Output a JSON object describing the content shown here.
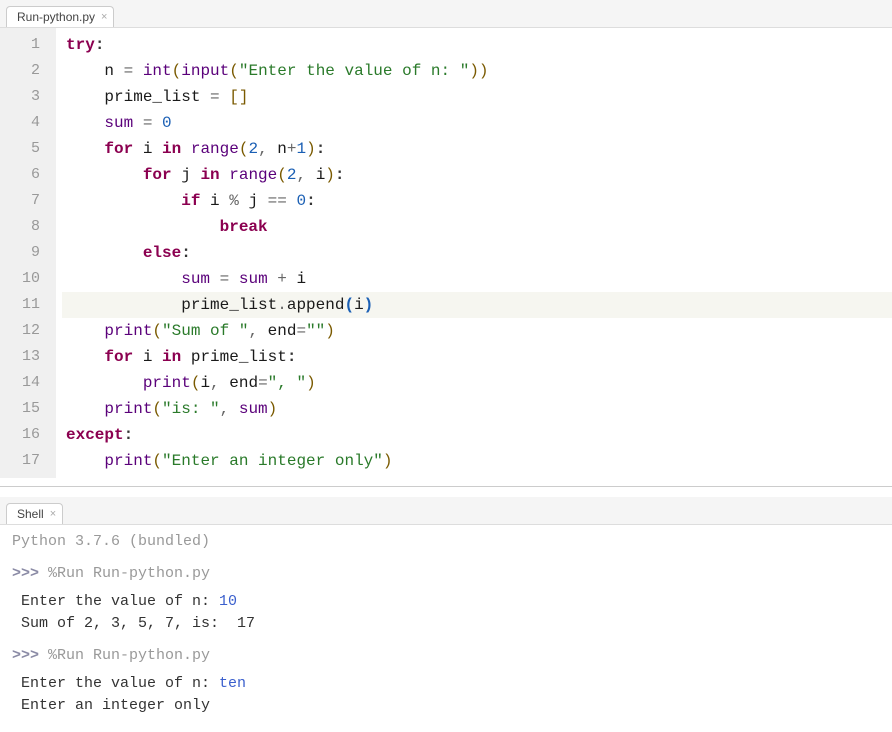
{
  "editor": {
    "tab": {
      "label": "Run-python.py"
    },
    "lineNumbers": [
      "1",
      "2",
      "3",
      "4",
      "5",
      "6",
      "7",
      "8",
      "9",
      "10",
      "11",
      "12",
      "13",
      "14",
      "15",
      "16",
      "17"
    ],
    "highlightLine": 11,
    "code": [
      {
        "indent": 0,
        "tokens": [
          {
            "t": "kw",
            "v": "try"
          },
          {
            "t": "bld",
            "v": ":"
          }
        ]
      },
      {
        "indent": 1,
        "tokens": [
          {
            "t": "name",
            "v": "n "
          },
          {
            "t": "op",
            "v": "="
          },
          {
            "t": "name",
            "v": " "
          },
          {
            "t": "bilt",
            "v": "int"
          },
          {
            "t": "par",
            "v": "("
          },
          {
            "t": "bilt",
            "v": "input"
          },
          {
            "t": "par",
            "v": "("
          },
          {
            "t": "str",
            "v": "\"Enter the value of n: \""
          },
          {
            "t": "par",
            "v": "))"
          }
        ]
      },
      {
        "indent": 1,
        "tokens": [
          {
            "t": "name",
            "v": "prime_list "
          },
          {
            "t": "op",
            "v": "="
          },
          {
            "t": "name",
            "v": " "
          },
          {
            "t": "par",
            "v": "[]"
          }
        ]
      },
      {
        "indent": 1,
        "tokens": [
          {
            "t": "bilt",
            "v": "sum"
          },
          {
            "t": "name",
            "v": " "
          },
          {
            "t": "op",
            "v": "="
          },
          {
            "t": "name",
            "v": " "
          },
          {
            "t": "num",
            "v": "0"
          }
        ]
      },
      {
        "indent": 1,
        "tokens": [
          {
            "t": "kw",
            "v": "for"
          },
          {
            "t": "name",
            "v": " i "
          },
          {
            "t": "kw",
            "v": "in"
          },
          {
            "t": "name",
            "v": " "
          },
          {
            "t": "bilt",
            "v": "range"
          },
          {
            "t": "par",
            "v": "("
          },
          {
            "t": "num",
            "v": "2"
          },
          {
            "t": "op",
            "v": ", "
          },
          {
            "t": "name",
            "v": "n"
          },
          {
            "t": "op",
            "v": "+"
          },
          {
            "t": "num",
            "v": "1"
          },
          {
            "t": "par",
            "v": ")"
          },
          {
            "t": "bld",
            "v": ":"
          }
        ]
      },
      {
        "indent": 2,
        "tokens": [
          {
            "t": "kw",
            "v": "for"
          },
          {
            "t": "name",
            "v": " j "
          },
          {
            "t": "kw",
            "v": "in"
          },
          {
            "t": "name",
            "v": " "
          },
          {
            "t": "bilt",
            "v": "range"
          },
          {
            "t": "par",
            "v": "("
          },
          {
            "t": "num",
            "v": "2"
          },
          {
            "t": "op",
            "v": ", "
          },
          {
            "t": "name",
            "v": "i"
          },
          {
            "t": "par",
            "v": ")"
          },
          {
            "t": "bld",
            "v": ":"
          }
        ]
      },
      {
        "indent": 3,
        "tokens": [
          {
            "t": "kw",
            "v": "if"
          },
          {
            "t": "name",
            "v": " i "
          },
          {
            "t": "op",
            "v": "%"
          },
          {
            "t": "name",
            "v": " j "
          },
          {
            "t": "op",
            "v": "=="
          },
          {
            "t": "name",
            "v": " "
          },
          {
            "t": "num",
            "v": "0"
          },
          {
            "t": "bld",
            "v": ":"
          }
        ]
      },
      {
        "indent": 4,
        "tokens": [
          {
            "t": "kw",
            "v": "break"
          }
        ]
      },
      {
        "indent": 2,
        "tokens": [
          {
            "t": "kw",
            "v": "else"
          },
          {
            "t": "bld",
            "v": ":"
          }
        ]
      },
      {
        "indent": 3,
        "tokens": [
          {
            "t": "bilt",
            "v": "sum"
          },
          {
            "t": "name",
            "v": " "
          },
          {
            "t": "op",
            "v": "="
          },
          {
            "t": "name",
            "v": " "
          },
          {
            "t": "bilt",
            "v": "sum"
          },
          {
            "t": "name",
            "v": " "
          },
          {
            "t": "op",
            "v": "+"
          },
          {
            "t": "name",
            "v": " i"
          }
        ]
      },
      {
        "indent": 3,
        "tokens": [
          {
            "t": "name",
            "v": "prime_list"
          },
          {
            "t": "op",
            "v": "."
          },
          {
            "t": "name",
            "v": "append"
          },
          {
            "t": "parb",
            "v": "("
          },
          {
            "t": "name",
            "v": "i"
          },
          {
            "t": "parb",
            "v": ")"
          }
        ]
      },
      {
        "indent": 1,
        "tokens": [
          {
            "t": "bilt",
            "v": "print"
          },
          {
            "t": "par",
            "v": "("
          },
          {
            "t": "str",
            "v": "\"Sum of \""
          },
          {
            "t": "op",
            "v": ", "
          },
          {
            "t": "name",
            "v": "end"
          },
          {
            "t": "op",
            "v": "="
          },
          {
            "t": "str",
            "v": "\"\""
          },
          {
            "t": "par",
            "v": ")"
          }
        ]
      },
      {
        "indent": 1,
        "tokens": [
          {
            "t": "kw",
            "v": "for"
          },
          {
            "t": "name",
            "v": " i "
          },
          {
            "t": "kw",
            "v": "in"
          },
          {
            "t": "name",
            "v": " prime_list"
          },
          {
            "t": "bld",
            "v": ":"
          }
        ]
      },
      {
        "indent": 2,
        "tokens": [
          {
            "t": "bilt",
            "v": "print"
          },
          {
            "t": "par",
            "v": "("
          },
          {
            "t": "name",
            "v": "i"
          },
          {
            "t": "op",
            "v": ", "
          },
          {
            "t": "name",
            "v": "end"
          },
          {
            "t": "op",
            "v": "="
          },
          {
            "t": "str",
            "v": "\", \""
          },
          {
            "t": "par",
            "v": ")"
          }
        ]
      },
      {
        "indent": 1,
        "tokens": [
          {
            "t": "bilt",
            "v": "print"
          },
          {
            "t": "par",
            "v": "("
          },
          {
            "t": "str",
            "v": "\"is: \""
          },
          {
            "t": "op",
            "v": ", "
          },
          {
            "t": "bilt",
            "v": "sum"
          },
          {
            "t": "par",
            "v": ")"
          }
        ]
      },
      {
        "indent": 0,
        "tokens": [
          {
            "t": "kw",
            "v": "except"
          },
          {
            "t": "bld",
            "v": ":"
          }
        ]
      },
      {
        "indent": 1,
        "tokens": [
          {
            "t": "bilt",
            "v": "print"
          },
          {
            "t": "par",
            "v": "("
          },
          {
            "t": "str",
            "v": "\"Enter an integer only\""
          },
          {
            "t": "par",
            "v": ")"
          }
        ]
      }
    ]
  },
  "shell": {
    "tab": {
      "label": "Shell"
    },
    "lines": [
      {
        "spans": [
          {
            "c": "sh-gray",
            "v": "Python 3.7.6 (bundled)"
          }
        ]
      },
      {
        "spans": [
          {
            "c": "sh-prompt",
            "v": ">>> "
          },
          {
            "c": "sh-gray",
            "v": "%Run Run-python.py"
          }
        ]
      },
      {
        "spans": [
          {
            "c": "",
            "v": " Enter the value of n: "
          },
          {
            "c": "sh-blue",
            "v": "10"
          }
        ]
      },
      {
        "spans": [
          {
            "c": "",
            "v": " Sum of 2, 3, 5, 7, is:  17"
          }
        ]
      },
      {
        "spans": [
          {
            "c": "sh-prompt",
            "v": ">>> "
          },
          {
            "c": "sh-gray",
            "v": "%Run Run-python.py"
          }
        ]
      },
      {
        "spans": [
          {
            "c": "",
            "v": " Enter the value of n: "
          },
          {
            "c": "sh-blue",
            "v": "ten"
          }
        ]
      },
      {
        "spans": [
          {
            "c": "",
            "v": " Enter an integer only"
          }
        ]
      }
    ]
  }
}
